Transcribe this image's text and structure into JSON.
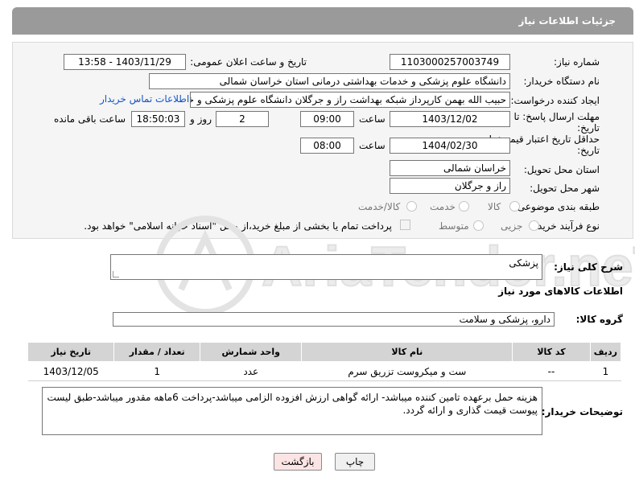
{
  "header": {
    "title": "جزئیات اطلاعات نیاز"
  },
  "form": {
    "need_number": {
      "label": "شماره نیاز:",
      "value": "1103000257003749"
    },
    "announce_datetime": {
      "label": "تاریخ و ساعت اعلان عمومی:",
      "value": "1403/11/29 - 13:58"
    },
    "buyer_org": {
      "label": "نام دستگاه خریدار:",
      "value": "دانشگاه علوم پزشکی و خدمات بهداشتی درمانی استان خراسان شمالی"
    },
    "requester": {
      "label": "ایجاد کننده درخواست:",
      "value": "حبیب الله بهمن کارپرداز شبکه بهداشت راز و جرگلان دانشگاه علوم پزشکی و خد",
      "contact_link": "اطلاعات تماس خریدار"
    },
    "reply_deadline": {
      "label_line1": "مهلت ارسال پاسخ: تا",
      "label_line2": "تاریخ:",
      "date": "1403/12/02",
      "time_label": "ساعت",
      "time": "09:00",
      "days": "2",
      "days_label": "روز و",
      "remaining": "18:50:03",
      "remaining_label": "ساعت باقی مانده"
    },
    "price_validity": {
      "label_line1": "حداقل تاریخ اعتبار قیمت: تا",
      "label_line2": "تاریخ:",
      "date": "1404/02/30",
      "time_label": "ساعت",
      "time": "08:00"
    },
    "delivery_province": {
      "label": "استان محل تحویل:",
      "value": "خراسان شمالی"
    },
    "delivery_city": {
      "label": "شهر محل تحویل:",
      "value": "راز و جرگلان"
    },
    "category": {
      "label": "طبقه بندی موضوعی:",
      "options": [
        "کالا",
        "خدمت",
        "کالا/خدمت"
      ]
    },
    "purchase_type": {
      "label": "نوع فرآیند خرید :",
      "options": [
        "جزیی",
        "متوسط"
      ],
      "payment_note": "پرداخت تمام یا بخشی از مبلغ خرید،از محل \"اسناد خزانه اسلامی\" خواهد بود."
    }
  },
  "summary": {
    "label": "شرح کلی نیاز:",
    "value": "پزشکی"
  },
  "goods_info_title": "اطلاعات کالاهای مورد نیاز",
  "goods_group": {
    "label": "گروه کالا:",
    "value": "دارو، پزشکی و سلامت"
  },
  "table": {
    "headers": [
      "ردیف",
      "کد کالا",
      "نام کالا",
      "واحد شمارش",
      "تعداد / مقدار",
      "تاریخ نیاز"
    ],
    "rows": [
      [
        "1",
        "--",
        "ست و میکروست تزریق سرم",
        "عدد",
        "1",
        "1403/12/05"
      ]
    ]
  },
  "buyer_notes": {
    "label": "توضیحات خریدار:",
    "value": "هزینه حمل برعهده تامین کننده میباشد- ارائه گواهی ارزش افزوده الزامی میباشد-پرداخت 6ماهه مقدور میباشد-طبق لیست پیوست قیمت گذاری و ارائه گردد."
  },
  "buttons": {
    "print": "چاپ",
    "back": "بازگشت"
  },
  "watermark": {
    "text": "AriaTender.neT"
  }
}
